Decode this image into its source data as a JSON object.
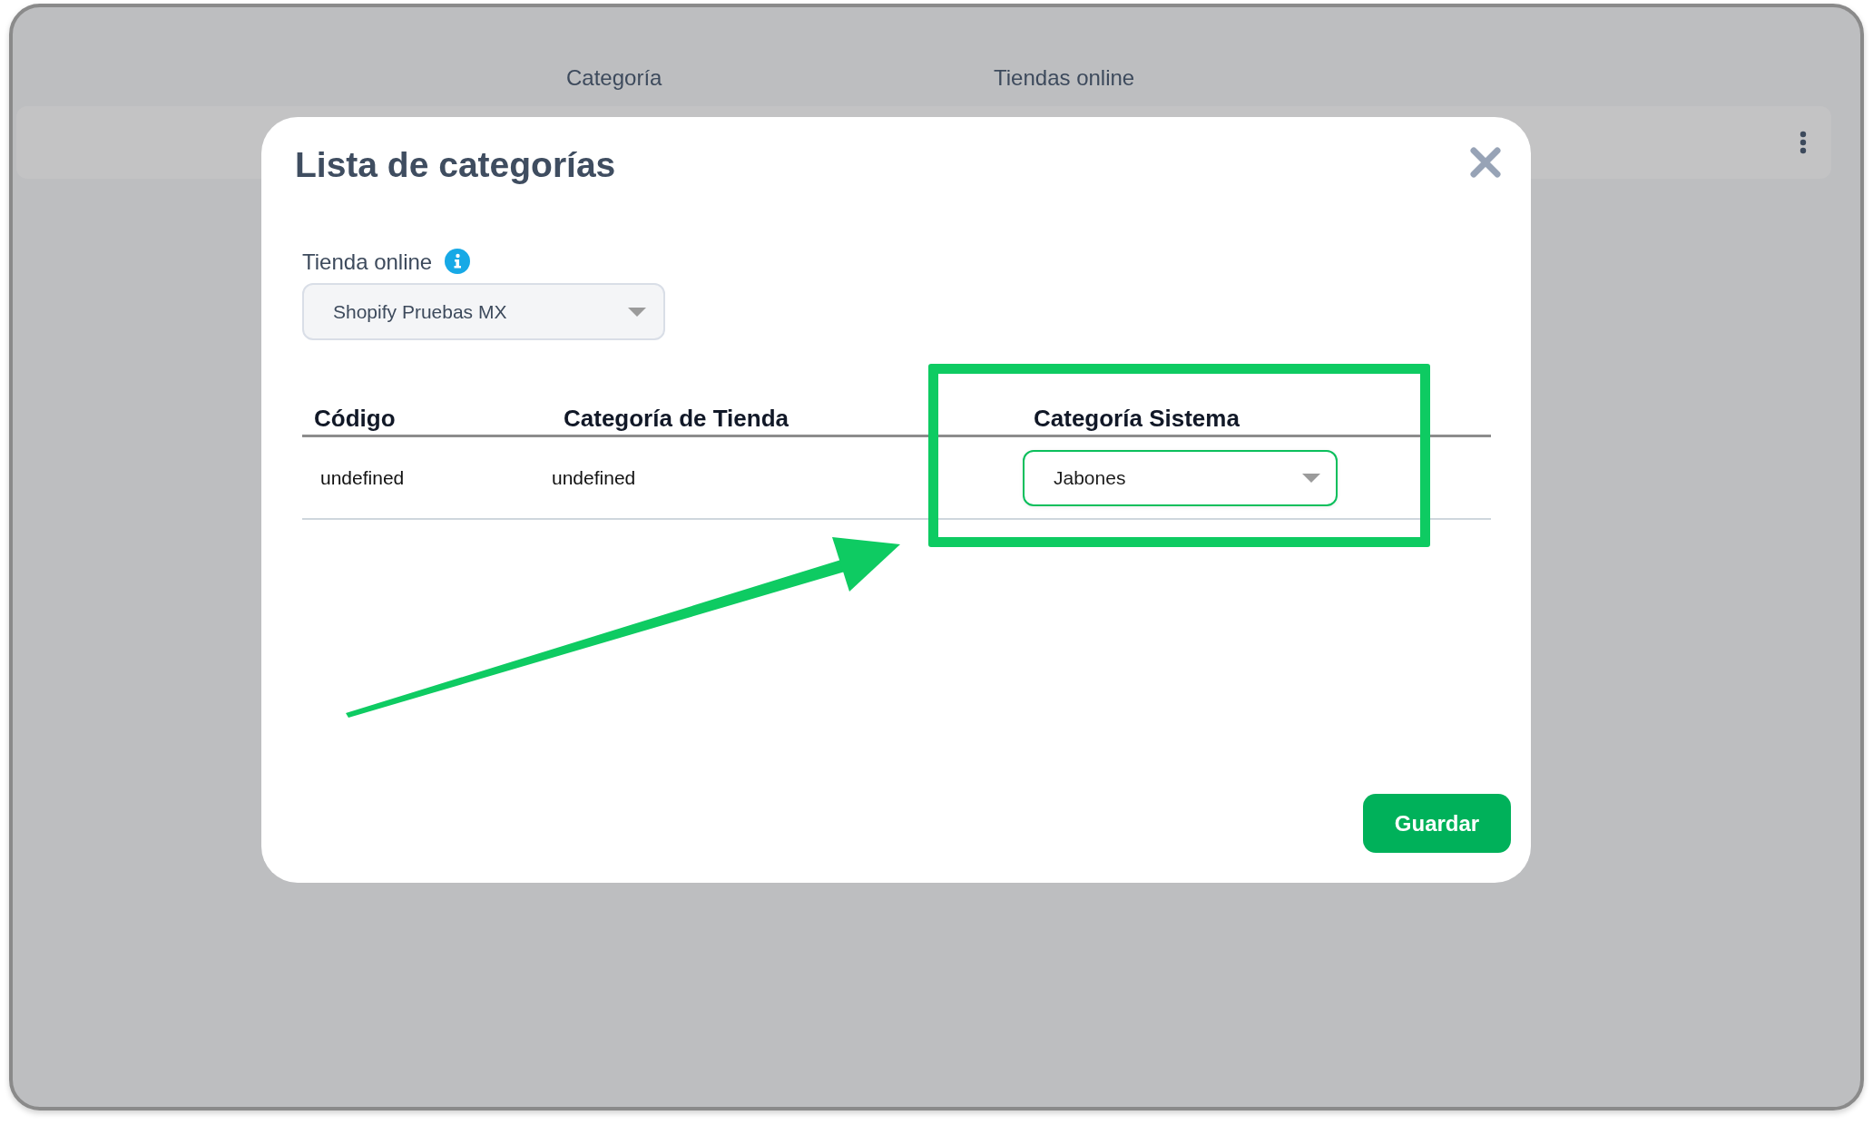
{
  "background": {
    "columns": [
      {
        "label": "Categoría"
      },
      {
        "label": "Tiendas online"
      }
    ]
  },
  "modal": {
    "title": "Lista de categorías",
    "store_field": {
      "label": "Tienda online",
      "value": "Shopify Pruebas MX"
    },
    "table": {
      "columns": [
        "Código",
        "Categoría de Tienda",
        "Categoría Sistema"
      ],
      "rows": [
        {
          "code": "undefined",
          "store_category": "undefined",
          "system_category": "Jabones"
        }
      ]
    },
    "buttons": [
      "Guardar"
    ]
  }
}
